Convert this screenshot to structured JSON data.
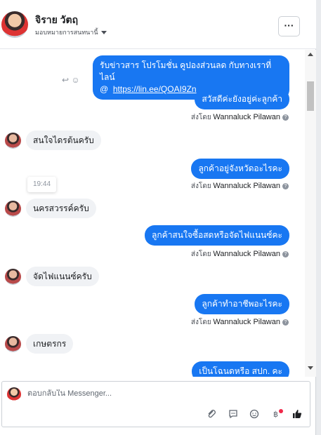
{
  "header": {
    "name": "จิราย วัตฤ",
    "assign_label": "มอบหมายการสนทนานี้",
    "more_label": "···"
  },
  "messages": {
    "out_1_line1": "รับข่าวสาร  โปรโมชั่น คูปองส่วนลด กับทางเราที่ไลน์",
    "out_1_at": "@",
    "out_1_link": "https://lin.ee/QOAI9Zn",
    "out_2": "สวัสดีค่ะยังอยู่ค่ะลูกค้า",
    "in_1": "สนใจไดรต้นครับ",
    "out_3": "ลูกค้าอยู่จังหวัดอะไรคะ",
    "in_2": "นครสวรรค์ครับ",
    "out_4": "ลูกค้าสนใจซื้อสดหรือจัดไฟแนนซ์คะ",
    "in_3": "จัดไฟแนนซ์ครับ",
    "out_5": "ลูกค้าทำอาชีพอะไรคะ",
    "in_4": "เกษตรกร",
    "out_6": "เป็นโฉนดหรือ สปก. คะ"
  },
  "sent_by": {
    "prefix": "ส่งโดย",
    "name": "Wannaluck Pilawan",
    "help": "?"
  },
  "timestamp": "19:44",
  "composer": {
    "placeholder": "ตอบกลับใน Messenger..."
  },
  "colors": {
    "accent": "#1877f2",
    "incoming_bubble": "#f0f2f5"
  }
}
